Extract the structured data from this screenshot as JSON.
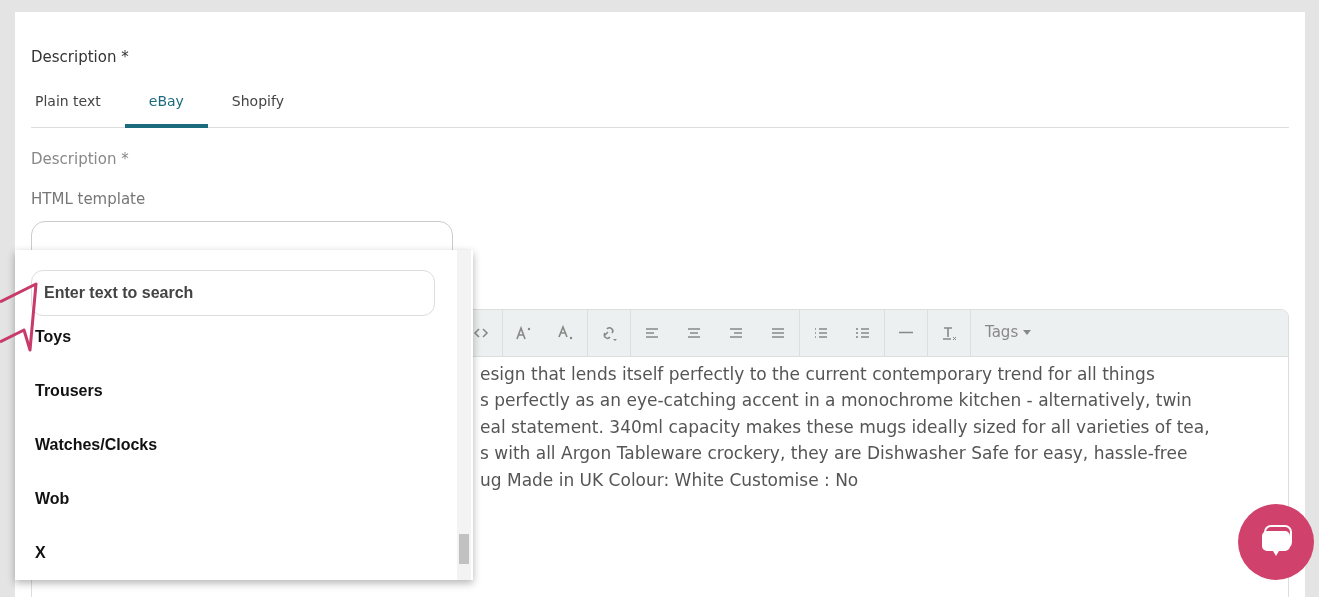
{
  "section_title": "Description *",
  "tabs": [
    {
      "label": "Plain text",
      "selected": false
    },
    {
      "label": "eBay",
      "selected": true
    },
    {
      "label": "Shopify",
      "selected": false
    }
  ],
  "field_label": "Description *",
  "template_label": "HTML template",
  "toolbar": [
    {
      "kind": "icon"
    },
    {
      "kind": "sep"
    },
    {
      "kind": "icon"
    },
    {
      "kind": "icon"
    },
    {
      "kind": "sep"
    },
    {
      "kind": "icon"
    },
    {
      "kind": "sep"
    },
    {
      "kind": "icon"
    },
    {
      "kind": "icon"
    },
    {
      "kind": "icon"
    },
    {
      "kind": "icon"
    },
    {
      "kind": "sep"
    },
    {
      "kind": "icon"
    },
    {
      "kind": "icon"
    },
    {
      "kind": "sep"
    },
    {
      "kind": "icon"
    },
    {
      "kind": "sep"
    },
    {
      "kind": "icon"
    },
    {
      "kind": "sep"
    },
    {
      "kind": "menu",
      "label": "Tags"
    }
  ],
  "editor_lines": [
    "esign that lends itself perfectly to the current contemporary trend for all things",
    "s perfectly as an eye-catching accent in a monochrome kitchen - alternatively, twin",
    "eal statement. 340ml capacity makes these mugs ideally sized for all varieties of tea,",
    "s with all Argon Tableware crockery, they are Dishwasher Safe for easy, hassle-free",
    "ug Made in UK Colour: White Customise : No"
  ],
  "dropdown": {
    "search": {
      "placeholder": "Enter text to search"
    },
    "options": [
      "Toys",
      "Trousers",
      "Watches/Clocks",
      "Wob",
      "X"
    ]
  }
}
